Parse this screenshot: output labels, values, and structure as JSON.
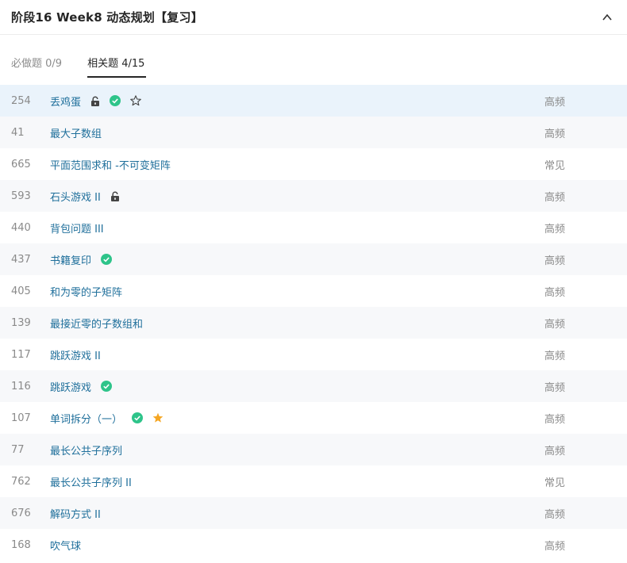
{
  "header": {
    "title": "阶段16  Week8 动态规划【复习】"
  },
  "tabs": [
    {
      "label": "必做题 0/9",
      "active": false
    },
    {
      "label": "相关题 4/15",
      "active": true
    }
  ],
  "colors": {
    "link": "#1f6f9b",
    "check": "#2ec48a",
    "star": "#f5a623",
    "highlight_row": "#eaf3fb"
  },
  "problems": [
    {
      "id": "254",
      "title": "丢鸡蛋",
      "freq": "高频",
      "locked": true,
      "solved": true,
      "star": "outline"
    },
    {
      "id": "41",
      "title": "最大子数组",
      "freq": "高频",
      "locked": false,
      "solved": false,
      "star": "none"
    },
    {
      "id": "665",
      "title": "平面范围求和 -不可变矩阵",
      "freq": "常见",
      "locked": false,
      "solved": false,
      "star": "none"
    },
    {
      "id": "593",
      "title": "石头游戏 II",
      "freq": "高频",
      "locked": true,
      "solved": false,
      "star": "none"
    },
    {
      "id": "440",
      "title": "背包问题 III",
      "freq": "高频",
      "locked": false,
      "solved": false,
      "star": "none"
    },
    {
      "id": "437",
      "title": "书籍复印",
      "freq": "高频",
      "locked": false,
      "solved": true,
      "star": "none"
    },
    {
      "id": "405",
      "title": "和为零的子矩阵",
      "freq": "高频",
      "locked": false,
      "solved": false,
      "star": "none"
    },
    {
      "id": "139",
      "title": "最接近零的子数组和",
      "freq": "高频",
      "locked": false,
      "solved": false,
      "star": "none"
    },
    {
      "id": "117",
      "title": "跳跃游戏 II",
      "freq": "高频",
      "locked": false,
      "solved": false,
      "star": "none"
    },
    {
      "id": "116",
      "title": "跳跃游戏",
      "freq": "高频",
      "locked": false,
      "solved": true,
      "star": "none"
    },
    {
      "id": "107",
      "title": "单词拆分（一）",
      "freq": "高频",
      "locked": false,
      "solved": true,
      "star": "filled"
    },
    {
      "id": "77",
      "title": "最长公共子序列",
      "freq": "高频",
      "locked": false,
      "solved": false,
      "star": "none"
    },
    {
      "id": "762",
      "title": "最长公共子序列 II",
      "freq": "常见",
      "locked": false,
      "solved": false,
      "star": "none"
    },
    {
      "id": "676",
      "title": "解码方式 II",
      "freq": "高频",
      "locked": false,
      "solved": false,
      "star": "none"
    },
    {
      "id": "168",
      "title": "吹气球",
      "freq": "高频",
      "locked": false,
      "solved": false,
      "star": "none"
    }
  ]
}
